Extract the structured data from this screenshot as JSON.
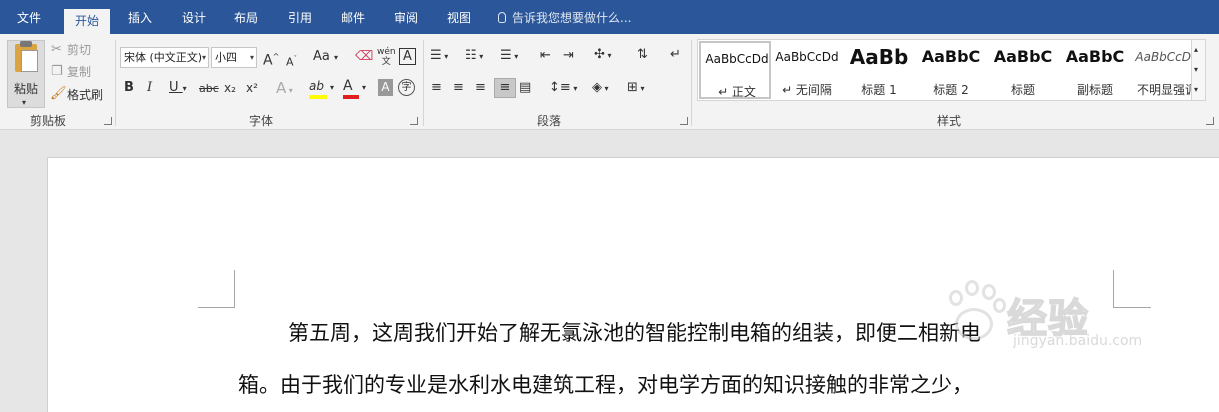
{
  "tabs": {
    "file": "文件",
    "home": "开始",
    "insert": "插入",
    "design": "设计",
    "layout": "布局",
    "references": "引用",
    "mailings": "邮件",
    "review": "审阅",
    "view": "视图",
    "tell_me": "告诉我您想要做什么..."
  },
  "clipboard": {
    "paste": "粘贴",
    "cut": "剪切",
    "copy": "复制",
    "format_painter": "格式刷",
    "group_label": "剪贴板"
  },
  "font": {
    "font_name": "宋体 (中文正文)",
    "font_size": "小四",
    "grow": "A",
    "shrink": "A",
    "case": "Aa",
    "phonetic": "wén",
    "border_char": "A",
    "bold": "B",
    "italic": "I",
    "underline": "U",
    "strike": "abc",
    "subscript": "x₂",
    "superscript": "x²",
    "text_effect": "A",
    "highlight": "ab",
    "font_color": "A",
    "char_shading": "A",
    "enclose": "字",
    "group_label": "字体"
  },
  "paragraph": {
    "group_label": "段落"
  },
  "styles": {
    "group_label": "样式",
    "items": [
      {
        "preview": "AaBbCcDd",
        "name": "↵ 正文"
      },
      {
        "preview": "AaBbCcDd",
        "name": "↵ 无间隔"
      },
      {
        "preview": "AaBb",
        "name": "标题 1"
      },
      {
        "preview": "AaBbC",
        "name": "标题 2"
      },
      {
        "preview": "AaBbC",
        "name": "标题"
      },
      {
        "preview": "AaBbC",
        "name": "副标题"
      },
      {
        "preview": "AaBbCcDd",
        "name": "不明显强调"
      }
    ]
  },
  "document": {
    "line1": "第五周，这周我们开始了解无氯泳池的智能控制电箱的组装，即便二相新电",
    "line2": "箱。由于我们的专业是水利水电建筑工程，对电学方面的知识接触的非常之少，"
  },
  "watermark": {
    "text": "经验",
    "url": "jingyan.baidu.com"
  },
  "colors": {
    "tabbar": "#2b579a",
    "highlight": "#ffff00",
    "font_color": "#e02020"
  }
}
